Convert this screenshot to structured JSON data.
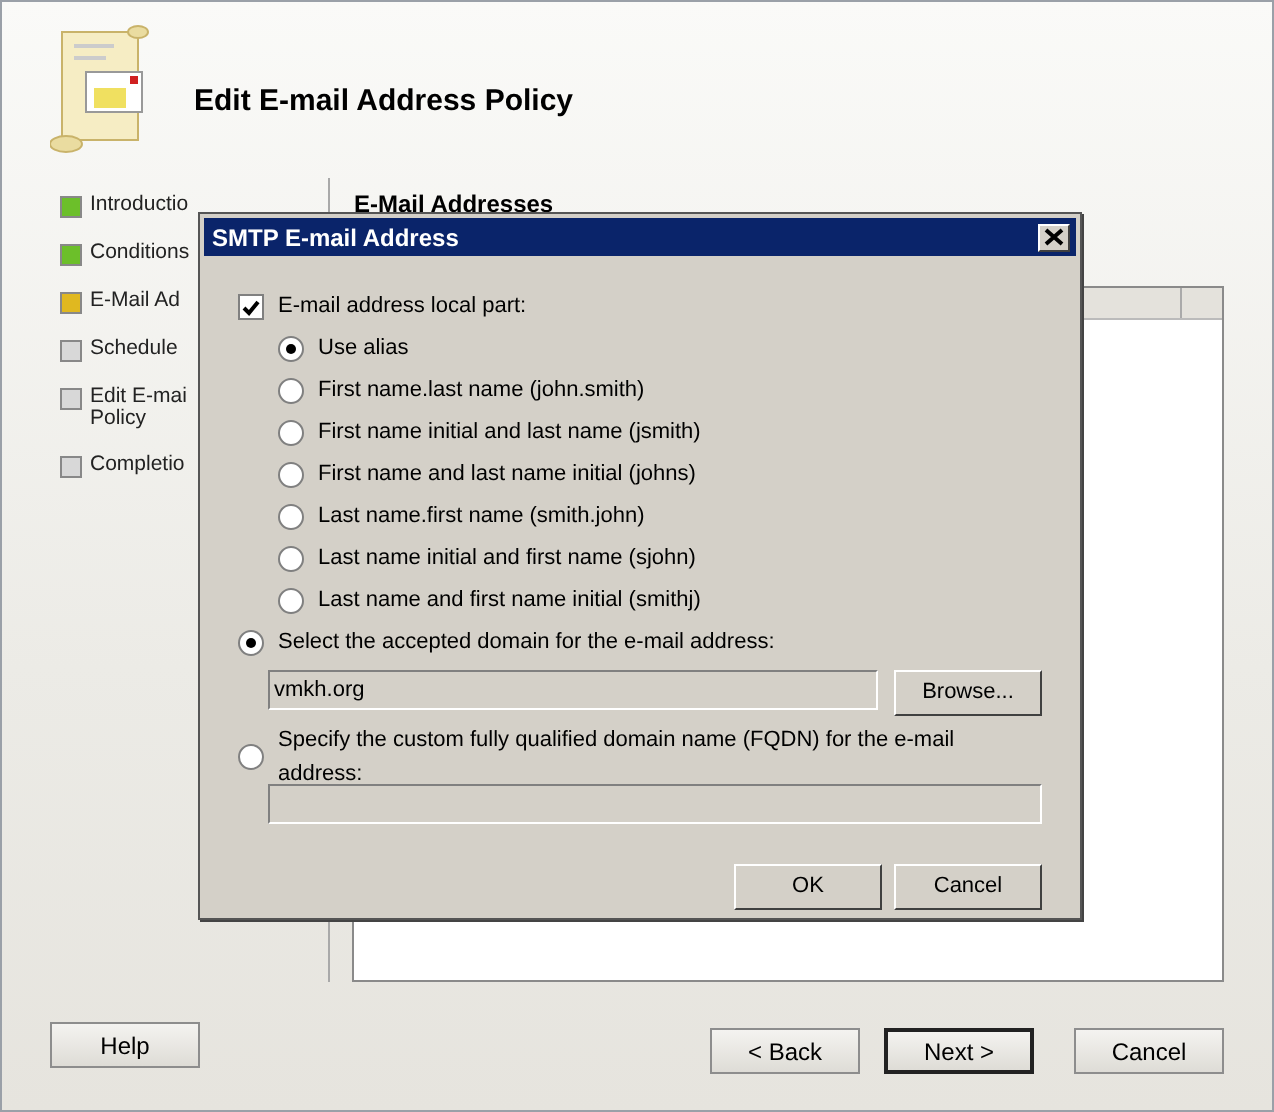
{
  "window": {
    "title": "Edit E-mail Address Policy"
  },
  "steps": [
    {
      "label": "Introductio",
      "color": "#6cbf2a"
    },
    {
      "label": "Conditions",
      "color": "#6cbf2a"
    },
    {
      "label": "E-Mail Ad",
      "color": "#e0b820"
    },
    {
      "label": "Schedule",
      "color": "#d8d8d8"
    },
    {
      "label": "Edit E-mai\nPolicy",
      "color": "#d8d8d8"
    },
    {
      "label": "Completio",
      "color": "#d8d8d8"
    }
  ],
  "page": {
    "heading": "E-Mail Addresses"
  },
  "buttons": [
    {
      "label": "Help",
      "default": false
    },
    {
      "label": "< Back",
      "default": false
    },
    {
      "label": "Next >",
      "default": true
    },
    {
      "label": "Cancel",
      "default": false
    }
  ],
  "dialog": {
    "title": "SMTP E-mail Address",
    "local_part": {
      "label": "E-mail address local part:",
      "checked": true
    },
    "formats": [
      {
        "label": "Use alias",
        "selected": true
      },
      {
        "label": "First name.last name (john.smith)",
        "selected": false
      },
      {
        "label": "First name initial and last name (jsmith)",
        "selected": false
      },
      {
        "label": "First name and last name initial (johns)",
        "selected": false
      },
      {
        "label": "Last name.first name (smith.john)",
        "selected": false
      },
      {
        "label": "Last name initial and first name (sjohn)",
        "selected": false
      },
      {
        "label": "Last name and first name initial (smithj)",
        "selected": false
      }
    ],
    "domain_options": [
      {
        "label": "Select the accepted domain for the e-mail address:",
        "selected": true,
        "value": "vmkh.org",
        "button": "Browse..."
      },
      {
        "label": "Specify the custom fully qualified domain name (FQDN) for the e-mail address:",
        "selected": false
      }
    ],
    "buttons": [
      {
        "label": "OK"
      },
      {
        "label": "Cancel"
      }
    ]
  }
}
